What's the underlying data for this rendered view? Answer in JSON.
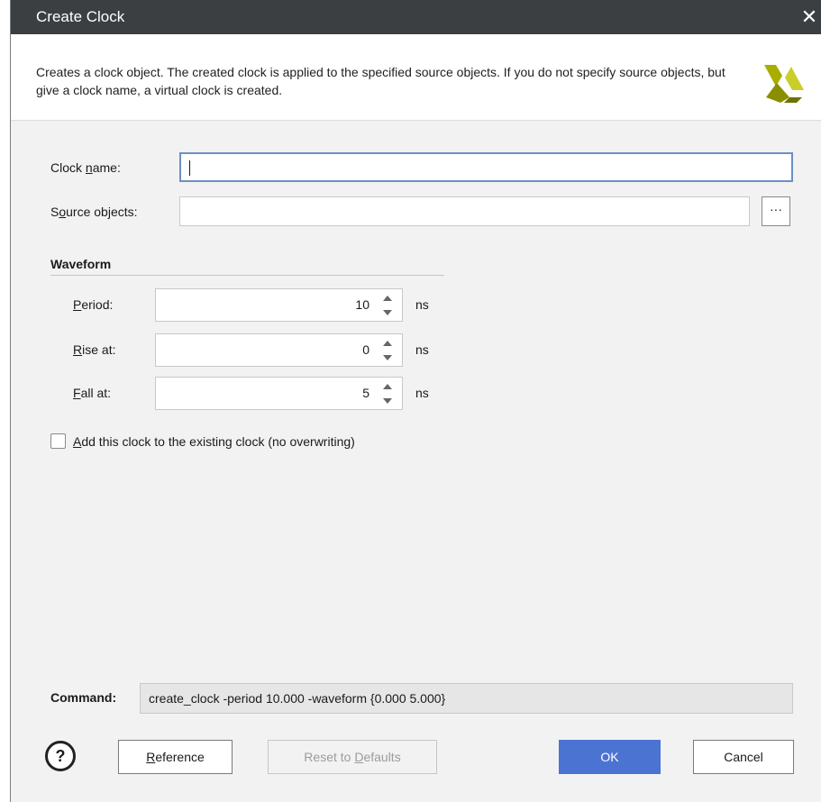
{
  "window": {
    "title": "Create Clock",
    "close_glyph": "✕"
  },
  "header": {
    "description": "Creates a clock object. The created clock is applied to the specified source objects. If you do not specify source objects, but give a clock name, a virtual clock is created.",
    "logo_icon": "xilinx-logo-icon"
  },
  "form": {
    "clock_name": {
      "label_pre": "Clock ",
      "label_mn": "n",
      "label_post": "ame:",
      "value": ""
    },
    "source_objects": {
      "label_pre": "S",
      "label_mn": "o",
      "label_post": "urce objects:",
      "value": "",
      "browse_label": "···"
    }
  },
  "waveform": {
    "title": "Waveform",
    "unit": "ns",
    "period": {
      "label_mn": "P",
      "label_post": "eriod:",
      "value": "10"
    },
    "rise_at": {
      "label_mn": "R",
      "label_post": "ise at:",
      "value": "0"
    },
    "fall_at": {
      "label_mn": "F",
      "label_post": "all at:",
      "value": "5"
    }
  },
  "add_clock": {
    "checked": false,
    "label_mn": "A",
    "label_post": "dd this clock to the existing clock (no overwriting)"
  },
  "command": {
    "label": "Command:",
    "value": "create_clock -period 10.000 -waveform {0.000 5.000}"
  },
  "buttons": {
    "help_glyph": "?",
    "reference": {
      "label_pre": "",
      "label_mn": "R",
      "label_post": "eference"
    },
    "reset": {
      "label_pre": "Reset to ",
      "label_mn": "D",
      "label_post": "efaults",
      "enabled": false
    },
    "ok": "OK",
    "cancel": "Cancel"
  },
  "colors": {
    "titlebar": "#3c3f41",
    "primary_button": "#4b74d2",
    "logo": "#a8ad00"
  }
}
